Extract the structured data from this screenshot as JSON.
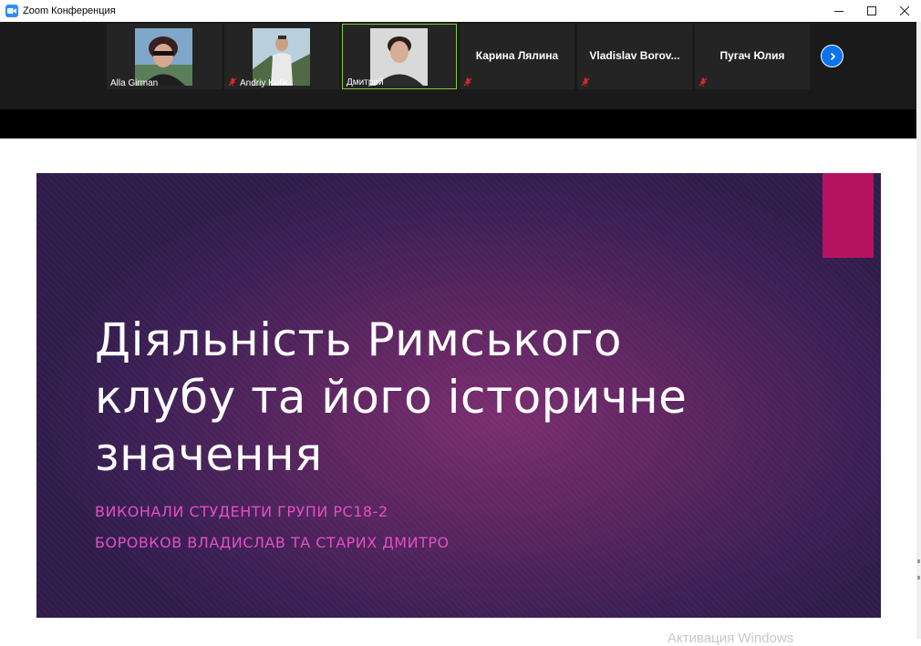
{
  "window": {
    "title": "Zoom Конференция",
    "icons": {
      "app": "zoom-camera-icon",
      "minimize": "minimize-icon",
      "maximize": "maximize-icon",
      "close": "close-icon"
    }
  },
  "participants": [
    {
      "name": "Alla Girman",
      "muted": false,
      "active": false,
      "has_video": true
    },
    {
      "name": "Andriy Kulik",
      "muted": true,
      "active": false,
      "has_video": true
    },
    {
      "name": "Дмитрий",
      "muted": false,
      "active": true,
      "has_video": true
    },
    {
      "name": "Карина Лялина",
      "muted": true,
      "active": false,
      "has_video": false
    },
    {
      "name": "Vladislav  Borov...",
      "muted": true,
      "active": false,
      "has_video": false
    },
    {
      "name": "Пугач Юлия",
      "muted": true,
      "active": false,
      "has_video": false
    }
  ],
  "gallery": {
    "next_icon": "chevron-right-icon"
  },
  "slide": {
    "title_lines": [
      "Діяльність Римського",
      "клубу та його історичне",
      "значення"
    ],
    "subtitle_1": "Виконали студенти групи РС18-2",
    "subtitle_2": "Боровков Владислав та Старих Дмитро",
    "colors": {
      "background": "#4a2259",
      "accent": "#b5135f",
      "subtitle": "#e44fc3"
    }
  },
  "watermark": "Активация Windows"
}
